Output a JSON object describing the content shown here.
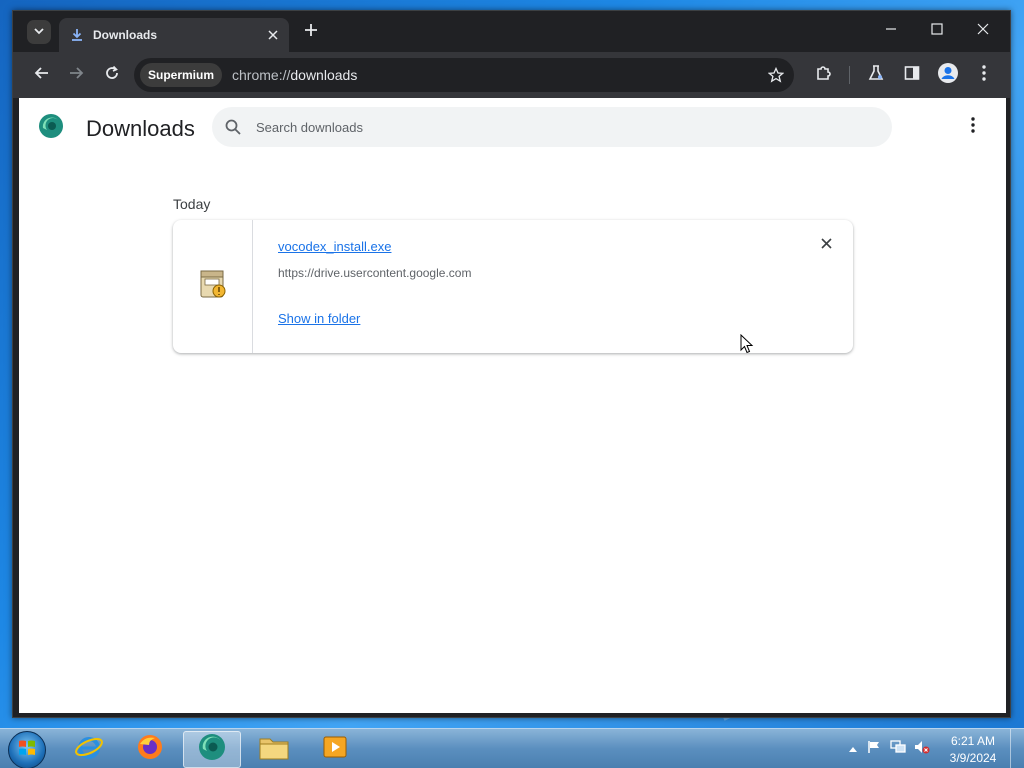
{
  "browser": {
    "tab": {
      "title": "Downloads"
    },
    "omnibox": {
      "chip": "Supermium",
      "url_scheme": "chrome://",
      "url_host": "downloads"
    }
  },
  "page": {
    "title": "Downloads",
    "search": {
      "placeholder": "Search downloads",
      "value": ""
    },
    "date_header": "Today",
    "downloads": [
      {
        "file_name": "vocodex_install.exe",
        "source_url": "https://drive.usercontent.google.com",
        "action_label": "Show in folder"
      }
    ]
  },
  "taskbar": {
    "apps": [
      "internet-explorer",
      "firefox",
      "supermium",
      "file-explorer",
      "media-player"
    ],
    "clock": {
      "time": "6:21 AM",
      "date": "3/9/2024"
    }
  },
  "colors": {
    "link": "#1a73e8",
    "frame": "#202124",
    "toolbar": "#35363a"
  }
}
